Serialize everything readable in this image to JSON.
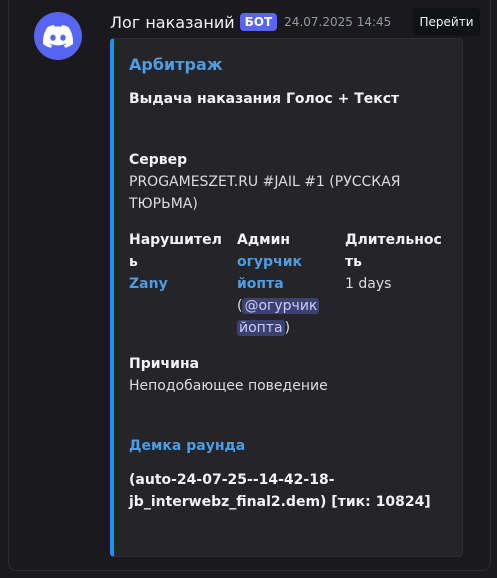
{
  "message": {
    "author": "Лог наказаний",
    "bot_tag": "БОТ",
    "timestamp": "24.07.2025 14:45",
    "goto_label": "Перейти"
  },
  "embed": {
    "accent_color": "#1e90ff",
    "author": "Арбитраж",
    "title": "Выдача наказания Голос + Текст",
    "fields": {
      "server_name": "Сервер",
      "server_value_line1": "PROGAMESZET.RU #JAIL #1 (РУССКАЯ",
      "server_value_line2": "ТЮРЬМА)",
      "violator_name_line1": "Нарушител",
      "violator_name_line2": "ь",
      "violator_value": "Zany",
      "admin_name": "Админ",
      "admin_link_line1": "огурчик",
      "admin_link_line2": "йопта",
      "admin_mention_open": "(",
      "admin_mention_line1": "@огурчик",
      "admin_mention_line2": "йопта",
      "admin_mention_close": ")",
      "duration_name_line1": "Длительнос",
      "duration_name_line2": "ть",
      "duration_value": "1 days",
      "reason_name": "Причина",
      "reason_value": "Неподобающее поведение",
      "demo_link": "Демка раунда",
      "demo_value_line1": "(auto-24-07-25--14-42-18-",
      "demo_value_line2": "jb_interwebz_final2.dem) [тик: 10824]"
    }
  },
  "icons": {
    "avatar": "discord-logo-icon"
  }
}
